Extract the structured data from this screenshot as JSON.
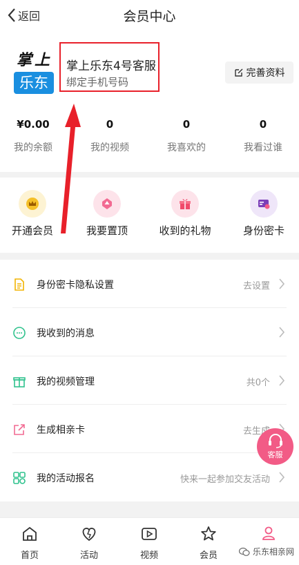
{
  "header": {
    "back_label": "返回",
    "title": "会员中心"
  },
  "profile": {
    "logo_top": "掌上",
    "logo_box": "乐东",
    "username": "掌上乐东4号客服",
    "bind_phone": "绑定手机号码",
    "edit_label": "完善资料"
  },
  "stats": [
    {
      "value": "¥0.00",
      "label": "我的余额"
    },
    {
      "value": "0",
      "label": "我的视频"
    },
    {
      "value": "0",
      "label": "我喜欢的"
    },
    {
      "value": "0",
      "label": "我看过谁"
    }
  ],
  "quick_actions": [
    {
      "label": "开通会员",
      "icon": "crown-icon",
      "bg": "#fdf3d3"
    },
    {
      "label": "我要置顶",
      "icon": "pin-top-icon",
      "bg": "#fde3ea"
    },
    {
      "label": "收到的礼物",
      "icon": "gift-icon",
      "bg": "#fde3ea"
    },
    {
      "label": "身份密卡",
      "icon": "id-card-icon",
      "bg": "#efe6f9"
    }
  ],
  "menu": [
    {
      "label": "身份密卡隐私设置",
      "value": "去设置",
      "icon": "document-icon"
    },
    {
      "label": "我收到的消息",
      "value": "",
      "icon": "message-icon"
    },
    {
      "label": "我的视频管理",
      "value": "共0个",
      "icon": "gift-box-icon"
    },
    {
      "label": "生成相亲卡",
      "value": "去生成",
      "icon": "share-icon"
    },
    {
      "label": "我的活动报名",
      "value": "快来一起参加交友活动",
      "icon": "grid-icon"
    }
  ],
  "floating": {
    "label": "客服",
    "icon": "headset-icon"
  },
  "tabs": [
    {
      "label": "首页",
      "icon": "home-icon"
    },
    {
      "label": "活动",
      "icon": "heart-icon"
    },
    {
      "label": "视频",
      "icon": "video-icon"
    },
    {
      "label": "会员",
      "icon": "star-icon"
    },
    {
      "label": "",
      "icon": "user-icon"
    }
  ],
  "watermark": "乐东相亲网",
  "colors": {
    "accent": "#f25b86",
    "highlight": "#e8202a",
    "logo_blue": "#1a8fe0"
  }
}
